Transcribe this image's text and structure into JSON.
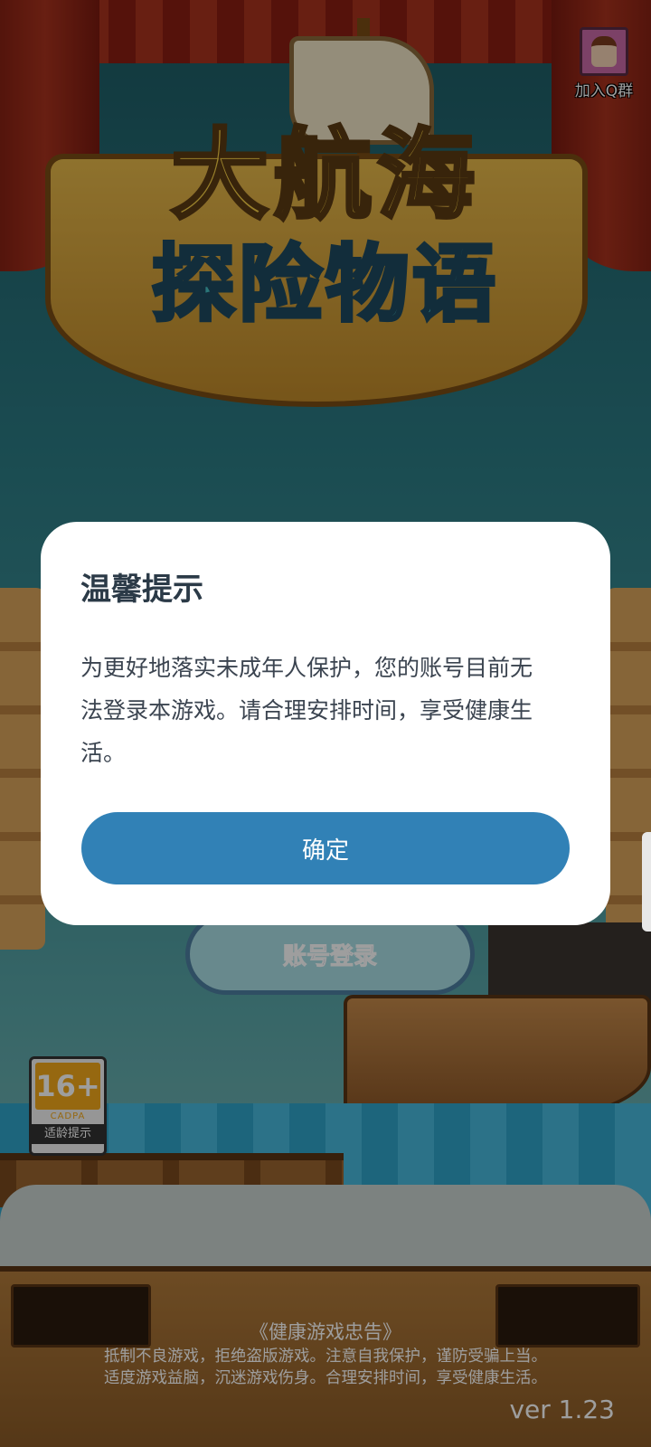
{
  "game": {
    "logo_line1": "大航海",
    "logo_line2": "探险物语"
  },
  "qq_group": {
    "label": "加入Q群"
  },
  "login_button": {
    "label": "账号登录"
  },
  "age_rating": {
    "age": "16+",
    "org": "CADPA",
    "note": "适龄提示"
  },
  "footer": {
    "health_title": "《健康游戏忠告》",
    "health_line1": "抵制不良游戏，拒绝盗版游戏。注意自我保护，谨防受骗上当。",
    "health_line2": "适度游戏益脑，沉迷游戏伤身。合理安排时间，享受健康生活。",
    "version": "ver 1.23"
  },
  "dialog": {
    "title": "温馨提示",
    "body_line1": "为更好地落实未成年人保护，您的账号目前无",
    "body_line2": "法登录本游戏。请合理安排时间，享受健康生",
    "body_line3": "活。",
    "confirm_label": "确定"
  },
  "colors": {
    "confirm_button": "#3181b6",
    "dialog_title": "#2b3a47",
    "dialog_body": "#3b4450"
  }
}
